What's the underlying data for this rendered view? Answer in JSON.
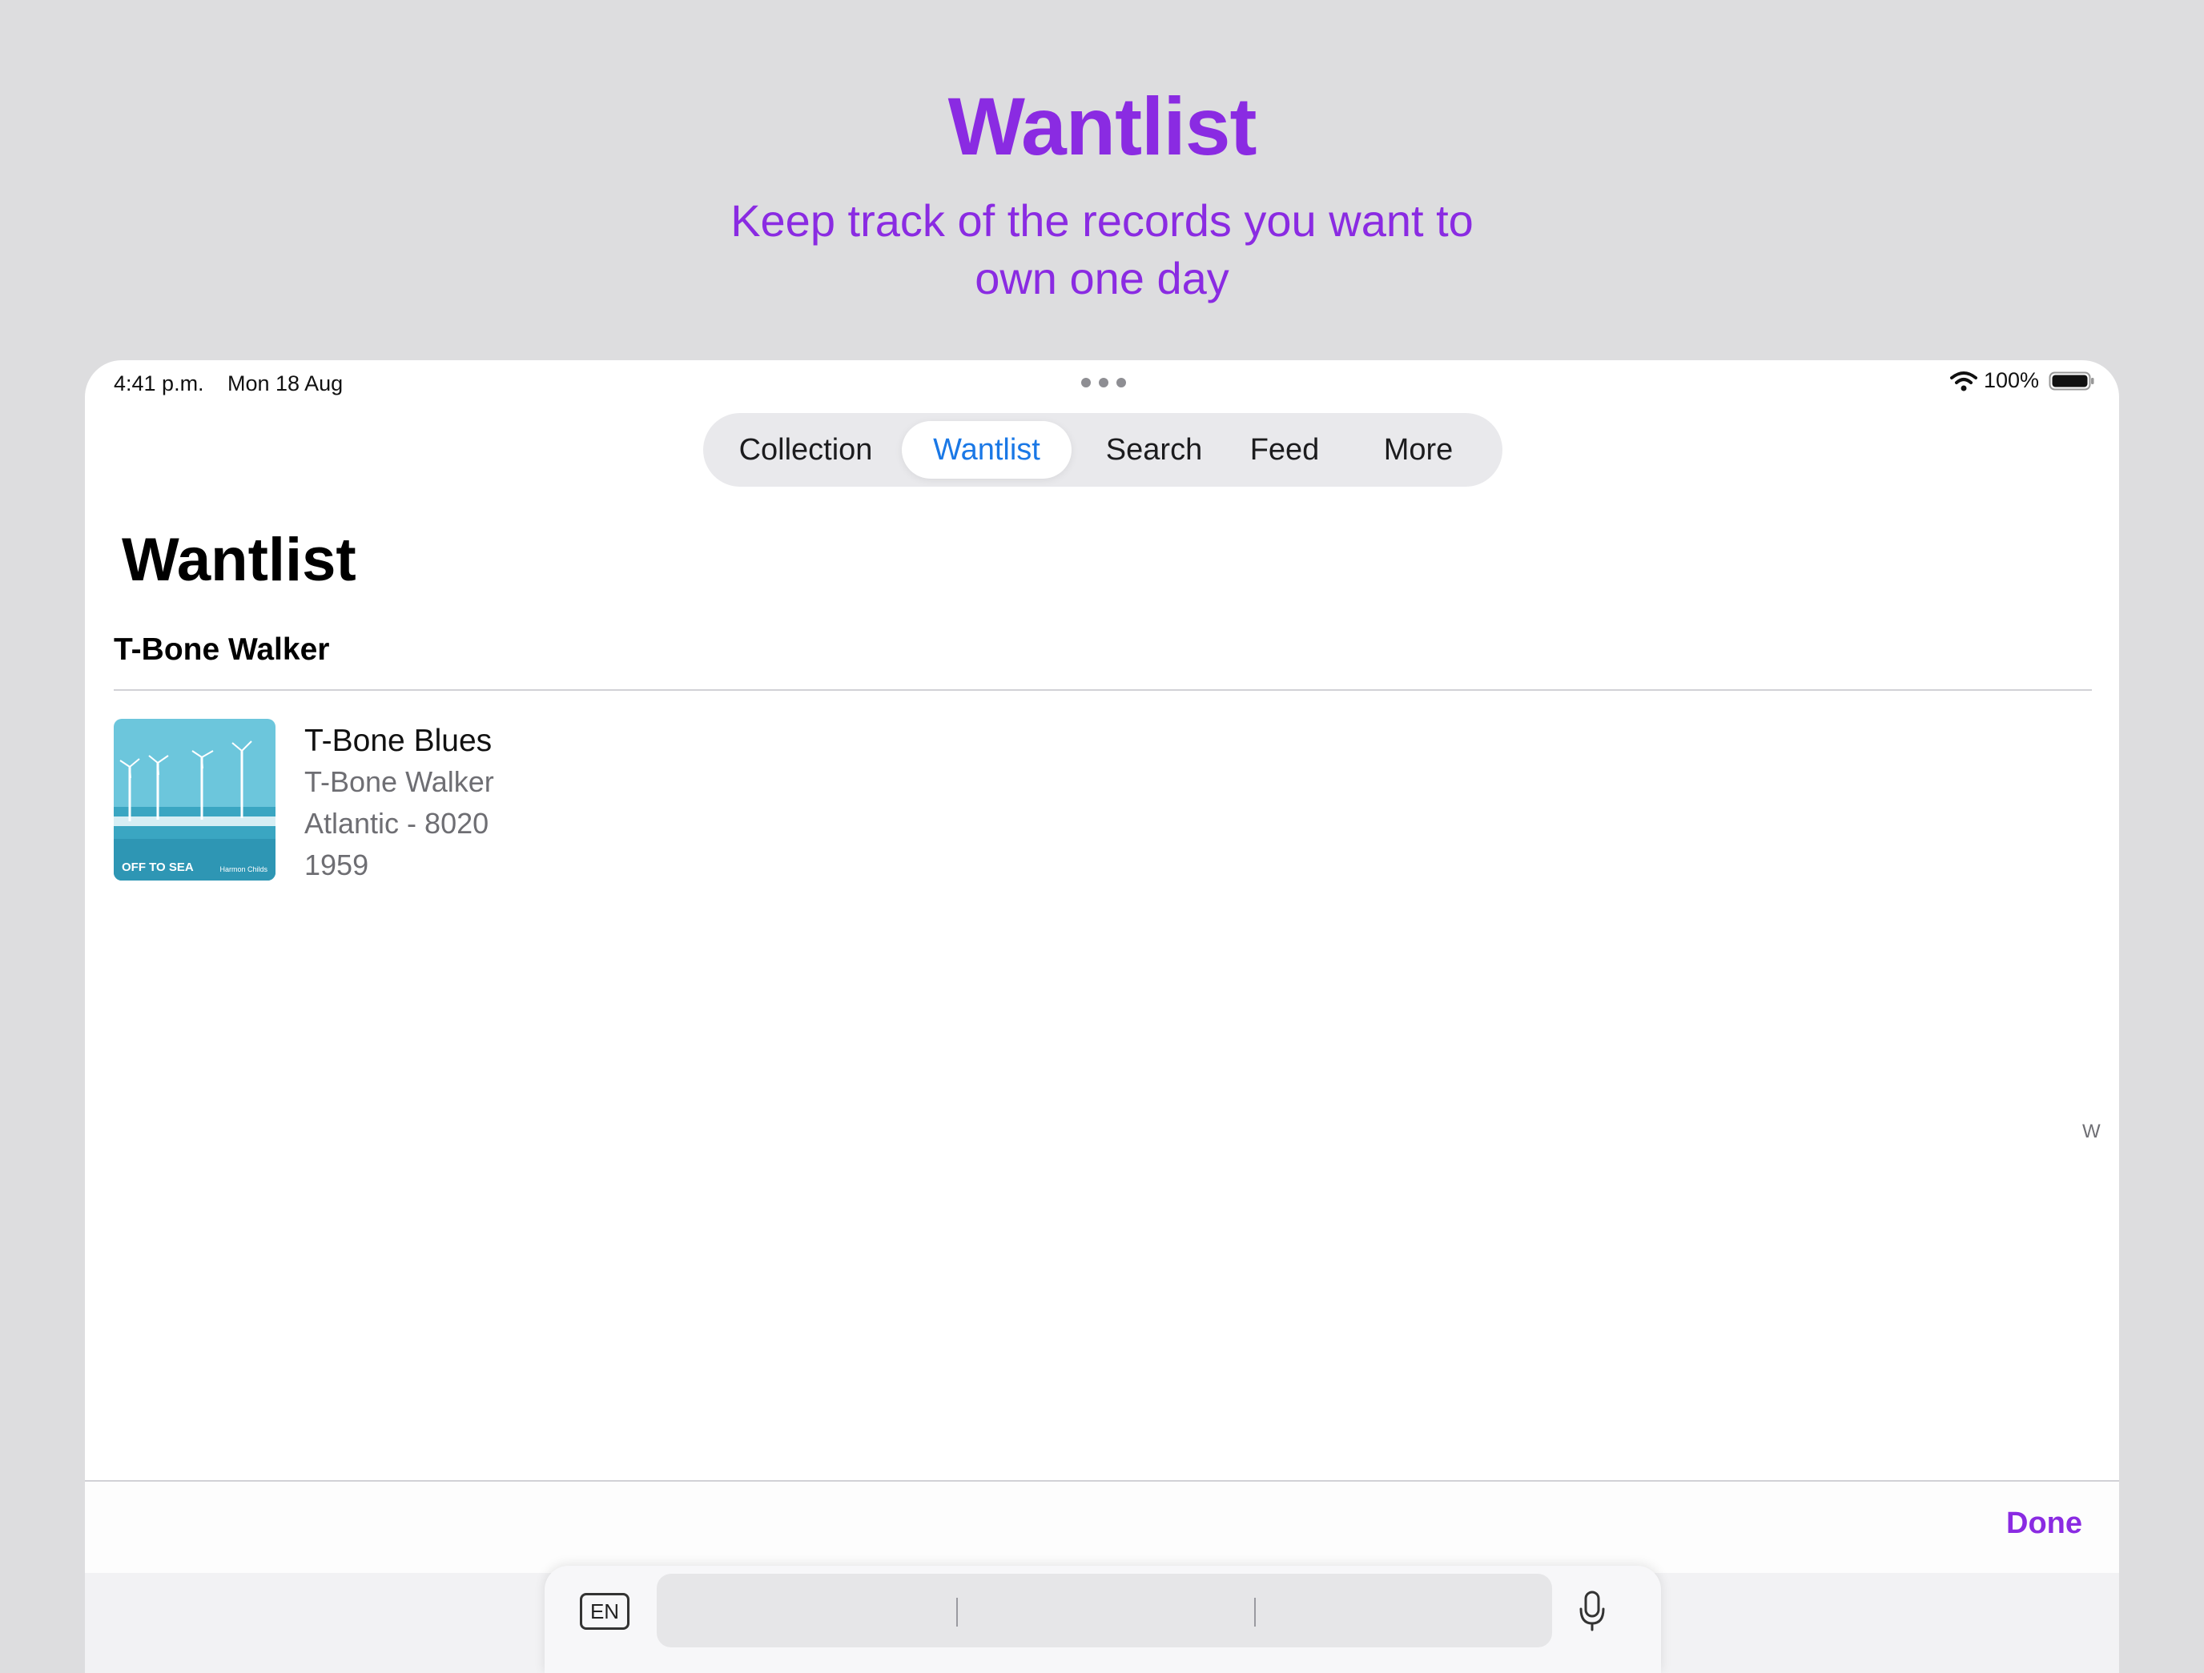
{
  "promo": {
    "title": "Wantlist",
    "subtitle_line1": "Keep track of the records you want to",
    "subtitle_line2": "own one day"
  },
  "status_bar": {
    "time": "4:41 p.m.",
    "date": "Mon 18 Aug",
    "battery": "100%"
  },
  "tabs": [
    {
      "label": "Collection"
    },
    {
      "label": "Wantlist"
    },
    {
      "label": "Search"
    },
    {
      "label": "Feed"
    },
    {
      "label": "More"
    }
  ],
  "active_tab": "Wantlist",
  "page": {
    "title": "Wantlist",
    "section_header": "T-Bone Walker",
    "index_letter": "W"
  },
  "items": [
    {
      "title": "T-Bone Blues",
      "artist": "T-Bone Walker",
      "label_catalog": "Atlantic - 8020",
      "year": "1959",
      "artwork_text": "OFF TO SEA",
      "artwork_subtext": "Harmon Childs"
    }
  ],
  "accessory": {
    "done_label": "Done"
  },
  "dictation": {
    "language_key": "EN"
  },
  "colors": {
    "accent": "#8a2be2",
    "tab_active": "#1a78e6",
    "background": "#dddddf"
  }
}
